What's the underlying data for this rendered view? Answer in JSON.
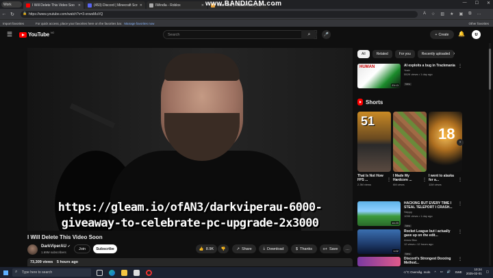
{
  "browser": {
    "profile_label": "Work",
    "tabs": [
      {
        "label": "I Will Delete This Video Soo",
        "color": "#ff0000",
        "active": true
      },
      {
        "label": "(453) Discord | Minecraft Screenfl",
        "color": "#5865f2",
        "active": false
      },
      {
        "label": "IWindla - Roblox",
        "color": "#aaaaaa",
        "active": false
      },
      {
        "label": "Obst Rbur | Roblox Wiki | Fandom",
        "color": "#e6a23c",
        "active": false
      }
    ],
    "new_tab": "+",
    "watermark": "www.BANDICAM.com",
    "url": "https://www.youtube.com/watch?v=3-xnwsMuVQ",
    "favorites_import": "Import favorites",
    "favorites_message": "For quick access, place your favorites here on the favorites bar.",
    "favorites_link": "Manage favorites now",
    "other_favorites": "Other favorites"
  },
  "yt": {
    "logo_word": "YouTube",
    "logo_country": "NO",
    "search_placeholder": "Search",
    "create_label": "Create"
  },
  "video": {
    "overlay_line1": "https://gleam.io/ofAN3/darkviperau-6000-",
    "overlay_line2": "giveaway-to-celebrate-pc-upgrade-2x3000",
    "title": "I Will Delete This Video Soon",
    "channel": "DarkViperAU",
    "subscribers": "1.69M subscribers",
    "join": "Join",
    "subscribe": "Subscribe",
    "likes": "8.9K",
    "share": "Share",
    "download": "Download",
    "thanks": "Thanks",
    "save": "Save",
    "views": "73,309 views",
    "posted": "5 hours ago"
  },
  "filters": [
    "All",
    "Related",
    "For you",
    "Recently uploaded"
  ],
  "recommendations": [
    {
      "title": "AI exploits a bug in Trackmania",
      "channel": "Yosh",
      "meta": "552K views • 1 day ago",
      "badge": "New",
      "duration": "23:13"
    },
    {
      "title": "HACKING BUT EVERY TIME I STEAL TELEPORT I CRASH...",
      "channel": "Skippy",
      "meta": "109K views • 1 day ago",
      "badge": "New",
      "duration": "14:23"
    },
    {
      "title": "Rocket League but i actually gave up on the edit...",
      "channel": "Amos Bloc",
      "meta": "12 views • 12 hours ago",
      "badge": "New",
      "duration": "1:02"
    },
    {
      "title": "Discord's Strongest Doxxing Method...",
      "channel": "",
      "meta": "",
      "badge": "",
      "duration": ""
    }
  ],
  "rec_thumb_text": "HUMAN",
  "shorts": {
    "heading": "Shorts",
    "items": [
      {
        "title": "That Is Not How FPS ...",
        "views": "2.3M views",
        "thumb_text": "51"
      },
      {
        "title": "I Made My Hardcore ...",
        "views": "6M views",
        "thumb_text": ""
      },
      {
        "title": "I went to alaska for a...",
        "views": "11M views",
        "thumb_text": "18"
      }
    ]
  },
  "taskbar": {
    "search_placeholder": "Type here to search",
    "weather": "-1°C  Overvåg. moln",
    "lang": "SWE",
    "time": "10:24",
    "date": "2025-02-01"
  }
}
